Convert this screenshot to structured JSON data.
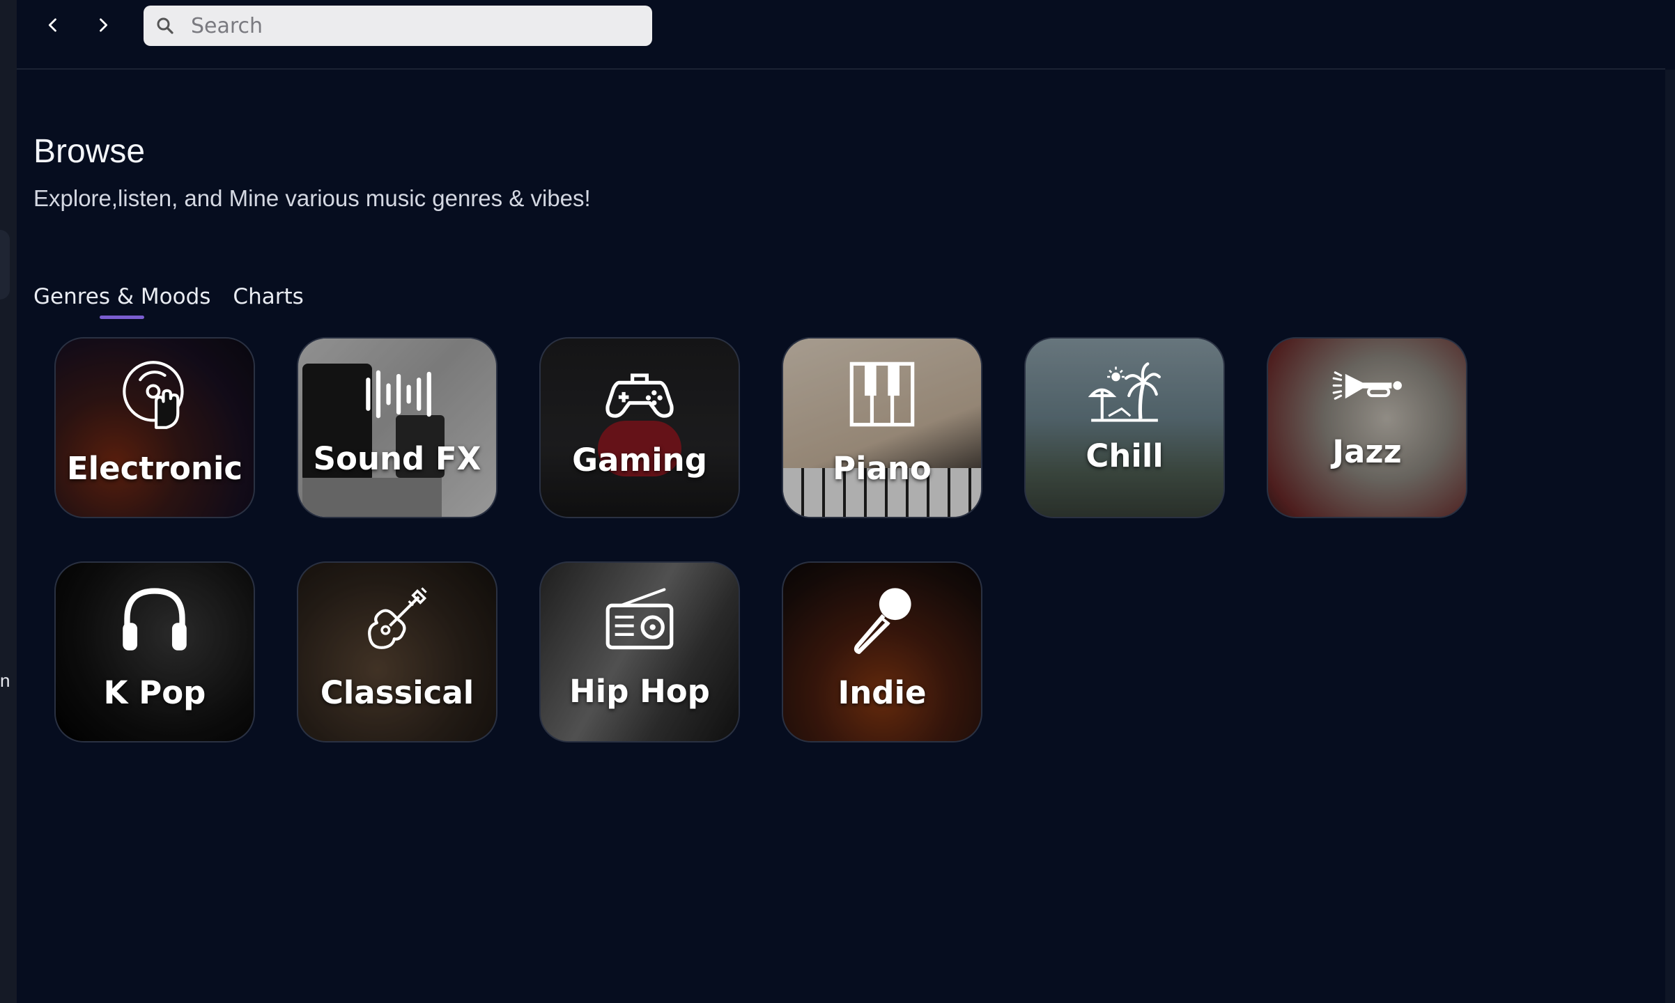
{
  "window": {
    "edge_char": "n"
  },
  "search": {
    "placeholder": "Search",
    "value": ""
  },
  "page": {
    "title": "Browse",
    "subtitle": "Explore,listen, and Mine various music genres & vibes!"
  },
  "tabs": [
    {
      "label": "Genres & Moods",
      "active": true
    },
    {
      "label": "Charts",
      "active": false
    }
  ],
  "genres": [
    {
      "label": "Electronic",
      "icon": "dj-turntable-icon"
    },
    {
      "label": "Sound FX",
      "icon": "sound-wave-icon"
    },
    {
      "label": "Gaming",
      "icon": "gamepad-icon"
    },
    {
      "label": "Piano",
      "icon": "piano-keys-icon"
    },
    {
      "label": "Chill",
      "icon": "beach-umbrella-palm-icon"
    },
    {
      "label": "Jazz",
      "icon": "trumpet-icon"
    },
    {
      "label": "K Pop",
      "icon": "headphones-icon"
    },
    {
      "label": "Classical",
      "icon": "guitar-icon"
    },
    {
      "label": "Hip Hop",
      "icon": "radio-icon"
    },
    {
      "label": "Indie",
      "icon": "microphone-icon"
    }
  ],
  "colors": {
    "background": "#060d1f",
    "tab_indicator": "#7a5ed0",
    "search_bg": "#ececee"
  }
}
